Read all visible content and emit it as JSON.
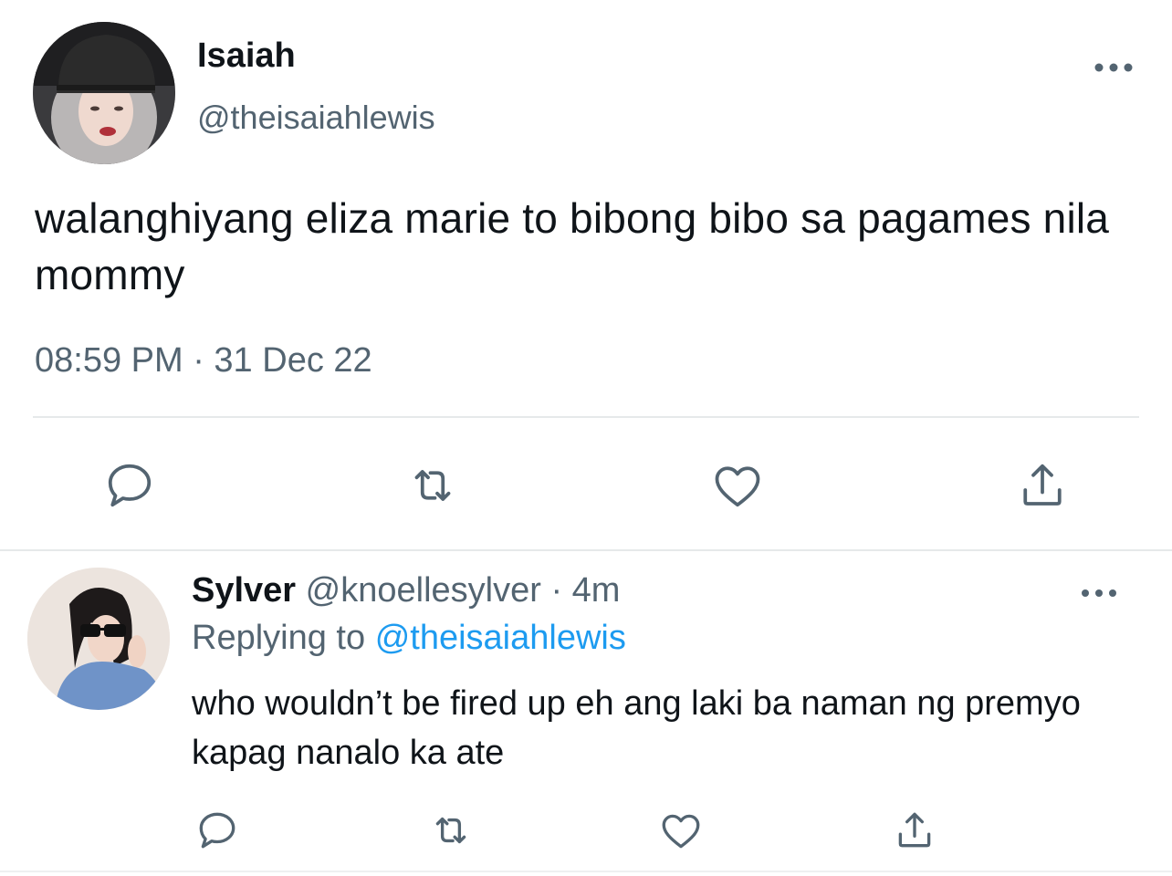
{
  "main_tweet": {
    "avatar_icon": "user-avatar-photo",
    "display_name": "Isaiah",
    "handle": "@theisaiahlewis",
    "more_icon": "more-horizontal-icon",
    "text": "walanghiyang eliza marie to bibong bibo sa pagames nila mommy",
    "timestamp": "08:59 PM · 31 Dec 22",
    "actions": [
      {
        "name": "reply",
        "icon": "reply-icon"
      },
      {
        "name": "retweet",
        "icon": "retweet-icon"
      },
      {
        "name": "like",
        "icon": "heart-icon"
      },
      {
        "name": "share",
        "icon": "share-icon"
      }
    ]
  },
  "reply_tweet": {
    "avatar_icon": "user-avatar-photo",
    "display_name": "Sylver",
    "handle_time": "@knoellesylver · 4m",
    "replying_prefix": "Replying to",
    "replying_to": "@theisaiahlewis",
    "text": "who wouldn’t be fired up eh ang laki ba naman ng premyo kapag nanalo ka ate",
    "more_icon": "more-horizontal-icon",
    "actions": [
      {
        "name": "reply",
        "icon": "reply-icon"
      },
      {
        "name": "retweet",
        "icon": "retweet-icon"
      },
      {
        "name": "like",
        "icon": "heart-icon"
      },
      {
        "name": "share",
        "icon": "share-icon"
      }
    ]
  },
  "colors": {
    "text": "#0f1419",
    "secondary": "#536471",
    "link": "#1d9bf0",
    "divider": "#e6e9ea"
  }
}
